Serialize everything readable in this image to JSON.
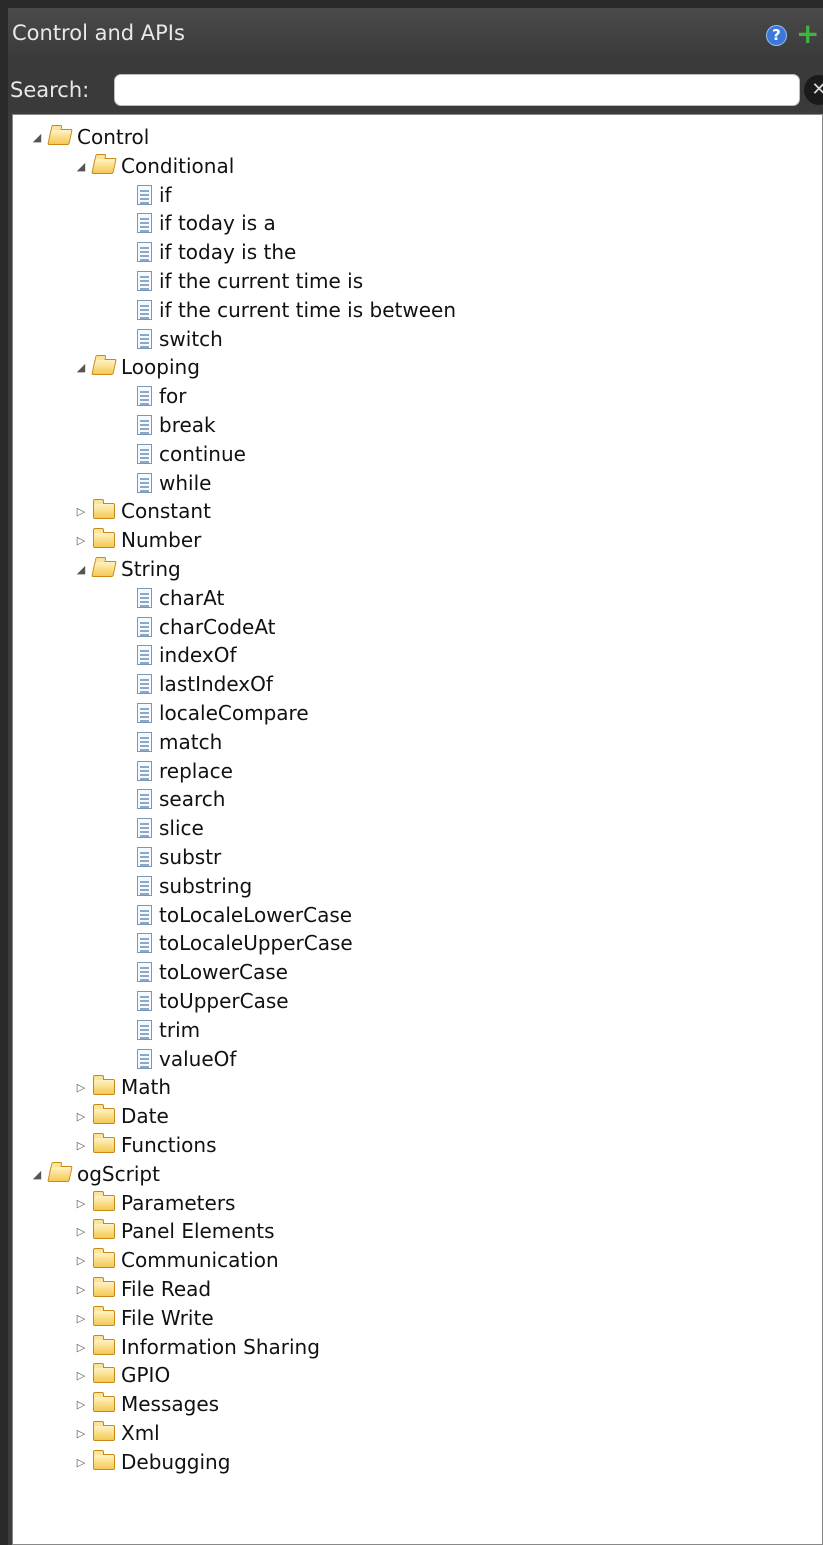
{
  "panel": {
    "title": "Control and APIs",
    "help_icon": "?",
    "add_icon": "+",
    "search_label": "Search:",
    "search_value": "",
    "clear_icon": "✕"
  },
  "tree": [
    {
      "label": "Control",
      "type": "folder",
      "expanded": true,
      "level": 0
    },
    {
      "label": "Conditional",
      "type": "folder",
      "expanded": true,
      "level": 1
    },
    {
      "label": "if",
      "type": "leaf",
      "level": 2
    },
    {
      "label": "if today is a",
      "type": "leaf",
      "level": 2
    },
    {
      "label": "if today is the",
      "type": "leaf",
      "level": 2
    },
    {
      "label": "if the current time is",
      "type": "leaf",
      "level": 2
    },
    {
      "label": "if the current time is between",
      "type": "leaf",
      "level": 2
    },
    {
      "label": "switch",
      "type": "leaf",
      "level": 2
    },
    {
      "label": "Looping",
      "type": "folder",
      "expanded": true,
      "level": 1
    },
    {
      "label": "for",
      "type": "leaf",
      "level": 2
    },
    {
      "label": "break",
      "type": "leaf",
      "level": 2
    },
    {
      "label": "continue",
      "type": "leaf",
      "level": 2
    },
    {
      "label": "while",
      "type": "leaf",
      "level": 2
    },
    {
      "label": "Constant",
      "type": "folder",
      "expanded": false,
      "level": 1
    },
    {
      "label": "Number",
      "type": "folder",
      "expanded": false,
      "level": 1
    },
    {
      "label": "String",
      "type": "folder",
      "expanded": true,
      "level": 1
    },
    {
      "label": "charAt",
      "type": "leaf",
      "level": 2
    },
    {
      "label": "charCodeAt",
      "type": "leaf",
      "level": 2
    },
    {
      "label": "indexOf",
      "type": "leaf",
      "level": 2
    },
    {
      "label": "lastIndexOf",
      "type": "leaf",
      "level": 2
    },
    {
      "label": "localeCompare",
      "type": "leaf",
      "level": 2
    },
    {
      "label": "match",
      "type": "leaf",
      "level": 2
    },
    {
      "label": "replace",
      "type": "leaf",
      "level": 2
    },
    {
      "label": "search",
      "type": "leaf",
      "level": 2
    },
    {
      "label": "slice",
      "type": "leaf",
      "level": 2
    },
    {
      "label": "substr",
      "type": "leaf",
      "level": 2
    },
    {
      "label": "substring",
      "type": "leaf",
      "level": 2
    },
    {
      "label": "toLocaleLowerCase",
      "type": "leaf",
      "level": 2
    },
    {
      "label": "toLocaleUpperCase",
      "type": "leaf",
      "level": 2
    },
    {
      "label": "toLowerCase",
      "type": "leaf",
      "level": 2
    },
    {
      "label": "toUpperCase",
      "type": "leaf",
      "level": 2
    },
    {
      "label": "trim",
      "type": "leaf",
      "level": 2
    },
    {
      "label": "valueOf",
      "type": "leaf",
      "level": 2
    },
    {
      "label": "Math",
      "type": "folder",
      "expanded": false,
      "level": 1
    },
    {
      "label": "Date",
      "type": "folder",
      "expanded": false,
      "level": 1
    },
    {
      "label": "Functions",
      "type": "folder",
      "expanded": false,
      "level": 1
    },
    {
      "label": "ogScript",
      "type": "folder",
      "expanded": true,
      "level": 0
    },
    {
      "label": "Parameters",
      "type": "folder",
      "expanded": false,
      "level": 1
    },
    {
      "label": "Panel Elements",
      "type": "folder",
      "expanded": false,
      "level": 1
    },
    {
      "label": "Communication",
      "type": "folder",
      "expanded": false,
      "level": 1
    },
    {
      "label": "File Read",
      "type": "folder",
      "expanded": false,
      "level": 1
    },
    {
      "label": "File Write",
      "type": "folder",
      "expanded": false,
      "level": 1
    },
    {
      "label": "Information Sharing",
      "type": "folder",
      "expanded": false,
      "level": 1
    },
    {
      "label": "GPIO",
      "type": "folder",
      "expanded": false,
      "level": 1
    },
    {
      "label": "Messages",
      "type": "folder",
      "expanded": false,
      "level": 1
    },
    {
      "label": "Xml",
      "type": "folder",
      "expanded": false,
      "level": 1
    },
    {
      "label": "Debugging",
      "type": "folder",
      "expanded": false,
      "level": 1
    }
  ]
}
